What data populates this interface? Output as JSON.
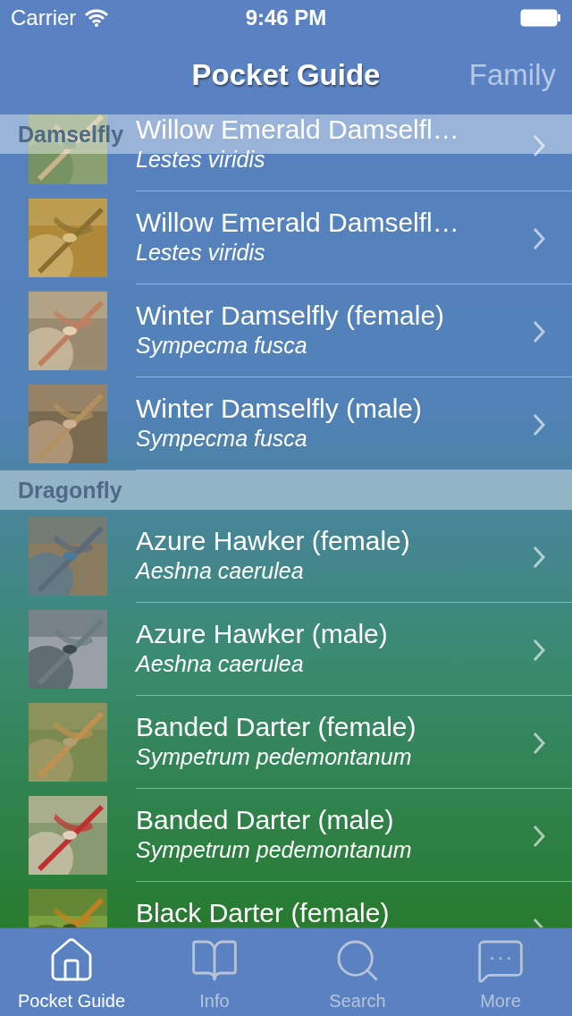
{
  "status_bar": {
    "carrier": "Carrier",
    "time": "9:46 PM"
  },
  "nav_bar": {
    "title": "Pocket Guide",
    "right_button": "Family"
  },
  "pinned_header": "Damselfly",
  "sections": [
    {
      "rows": [
        {
          "name": "Willow Emerald Damselfl…",
          "latin": "Lestes viridis"
        },
        {
          "name": "Willow Emerald Damselfl…",
          "latin": "Lestes viridis"
        },
        {
          "name": "Winter Damselfly (female)",
          "latin": "Sympecma fusca"
        },
        {
          "name": "Winter Damselfly (male)",
          "latin": "Sympecma fusca"
        }
      ]
    },
    {
      "title": "Dragonfly",
      "rows": [
        {
          "name": "Azure Hawker (female)",
          "latin": "Aeshna caerulea"
        },
        {
          "name": "Azure Hawker (male)",
          "latin": "Aeshna caerulea"
        },
        {
          "name": "Banded Darter (female)",
          "latin": "Sympetrum pedemontanum"
        },
        {
          "name": "Banded Darter (male)",
          "latin": "Sympetrum pedemontanum"
        },
        {
          "name": "Black Darter (female)"
        }
      ]
    }
  ],
  "tabs": [
    {
      "label": "Pocket Guide",
      "selected": true
    },
    {
      "label": "Info",
      "selected": false
    },
    {
      "label": "Search",
      "selected": false
    },
    {
      "label": "More",
      "selected": false
    }
  ]
}
